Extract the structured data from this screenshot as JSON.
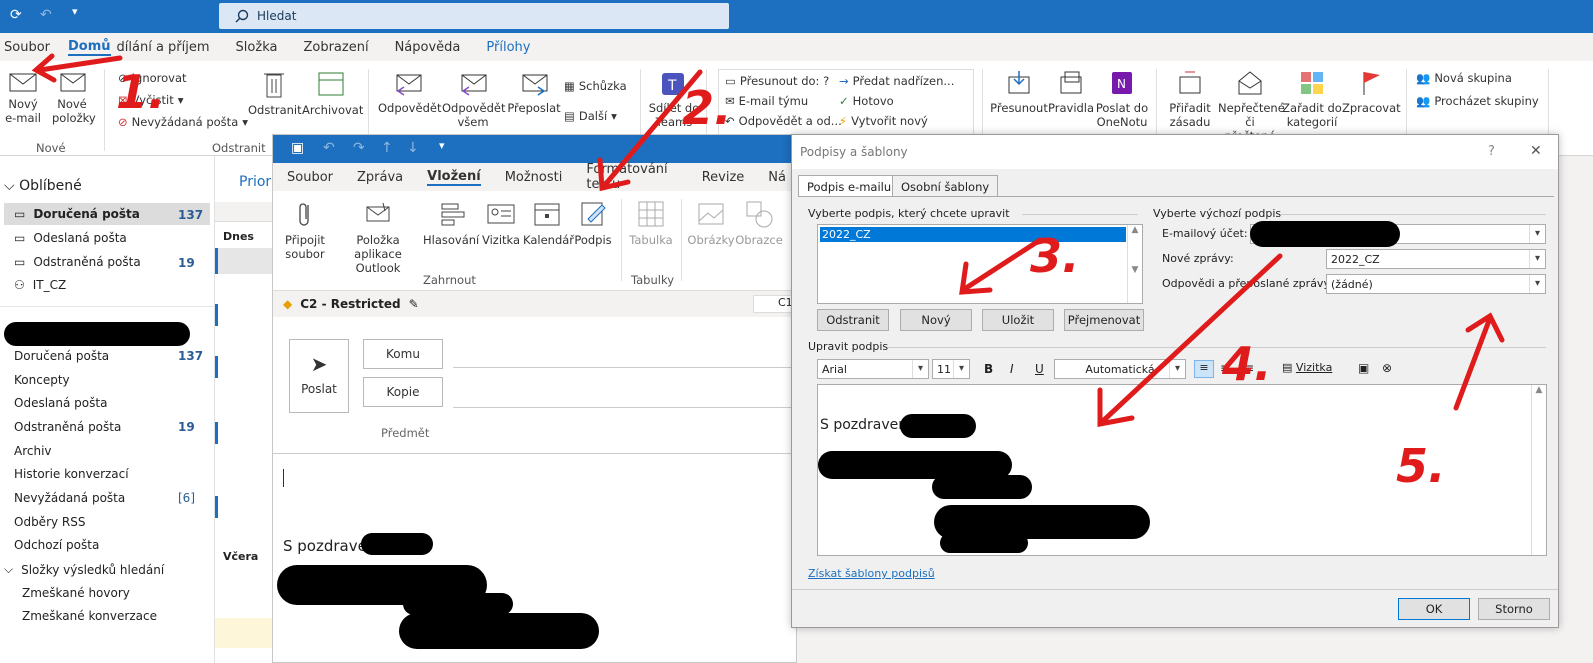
{
  "search": {
    "placeholder": "Hledat"
  },
  "menu": {
    "items": [
      "Soubor",
      "Domů",
      "dílání a příjem",
      "Složka",
      "Zobrazení",
      "Nápověda",
      "Přílohy"
    ]
  },
  "ribbon": {
    "new_email": "Nový e-mail",
    "new_items": "Nové položky",
    "ignore": "Ignorovat",
    "clean": "Vyčistit",
    "junk": "Nevyžádaná pošta",
    "delete": "Odstranit",
    "archive": "Archivovat",
    "reply": "Odpovědět",
    "reply_all": "Odpovědět všem",
    "forward": "Přeposlat",
    "meeting": "Schůzka",
    "more": "Další",
    "teams": "Sdílet do Teams",
    "move_to": "Přesunout do: ?",
    "team_email": "E-mail týmu",
    "reply_del": "Odpovědět a od...",
    "to_manager": "Předat nadřízen...",
    "done": "Hotovo",
    "create_new": "Vytvořit nový",
    "move": "Přesunout",
    "rules": "Pravidla",
    "onenote": "Poslat do OneNotu",
    "assign_policy": "Přiřadit zásadu",
    "unread": "Nepřečtené či přečtené",
    "categorize": "Zařadit do kategorií",
    "process": "Zpracovat",
    "new_group": "Nová skupina",
    "browse_groups": "Procházet skupiny",
    "group_new": "Nové",
    "group_delete": "Odstranit"
  },
  "nav": {
    "favorites": "Oblíbené",
    "items_fav": [
      {
        "label": "Doručená pošta",
        "count": "137"
      },
      {
        "label": "Odeslaná pošta",
        "count": ""
      },
      {
        "label": "Odstraněná pošta",
        "count": "19"
      },
      {
        "label": "IT_CZ",
        "count": ""
      }
    ],
    "items": [
      {
        "label": "Doručená pošta",
        "count": "137"
      },
      {
        "label": "Koncepty",
        "count": ""
      },
      {
        "label": "Odeslaná pošta",
        "count": ""
      },
      {
        "label": "Odstraněná pošta",
        "count": "19"
      },
      {
        "label": "Archiv",
        "count": ""
      },
      {
        "label": "Historie konverzací",
        "count": ""
      },
      {
        "label": "Nevyžádaná pošta",
        "count": "[6]"
      },
      {
        "label": "Odběry RSS",
        "count": ""
      },
      {
        "label": "Odchozí pošta",
        "count": ""
      },
      {
        "label": "Složky výsledků hledání",
        "count": ""
      },
      {
        "label": "Zmeškané hovory",
        "count": ""
      },
      {
        "label": "Zmeškané konverzace",
        "count": ""
      }
    ]
  },
  "list": {
    "prior": "Prior",
    "today": "Dnes",
    "yesterday": "Včera"
  },
  "compose": {
    "tabs": [
      "Soubor",
      "Zpráva",
      "Vložení",
      "Možnosti",
      "Formátování textu",
      "Revize",
      "Ná"
    ],
    "attach": "Připojit soubor",
    "outlook_item": "Položka aplikace Outlook",
    "voting": "Hlasování",
    "card": "Vizitka",
    "calendar": "Kalendář",
    "signature": "Podpis",
    "table": "Tabulka",
    "pictures": "Obrázky",
    "shapes": "Obrazce",
    "group_include": "Zahrnout",
    "group_tables": "Tabulky",
    "sensitivity": "C2 - Restricted",
    "c1": "C1",
    "send": "Poslat",
    "to": "Komu",
    "cc": "Kopie",
    "subject": "Předmět",
    "greeting": "S pozdravem"
  },
  "dialog": {
    "title": "Podpisy a šablony",
    "tab_email_sig": "Podpis e-mailu",
    "tab_personal": "Osobní šablony",
    "select_edit": "Vyberte podpis, který chcete upravit",
    "selected_sig": "2022_CZ",
    "btn_delete": "Odstranit",
    "btn_new": "Nový",
    "btn_save": "Uložit",
    "btn_rename": "Přejmenovat",
    "select_default": "Vyberte výchozí podpis",
    "email_account": "E-mailový účet:",
    "new_messages": "Nové zprávy:",
    "new_messages_val": "2022_CZ",
    "replies": "Odpovědi a přeposlané zprávy:",
    "replies_val": "(žádné)",
    "edit_sig": "Upravit podpis",
    "font": "Arial",
    "size": "11",
    "bold": "B",
    "italic": "I",
    "underline": "U",
    "color": "Automatická",
    "card_btn": "Vizitka",
    "sig_greeting": "S pozdravem",
    "get_templates": "Získat šablony podpisů",
    "ok": "OK",
    "cancel": "Storno",
    "help": "?",
    "close": "✕"
  },
  "annotations": [
    "1.",
    "2.",
    "3.",
    "4.",
    "5."
  ],
  "colors": {
    "accent": "#1d6fbf",
    "annotation": "#e01b1b"
  }
}
